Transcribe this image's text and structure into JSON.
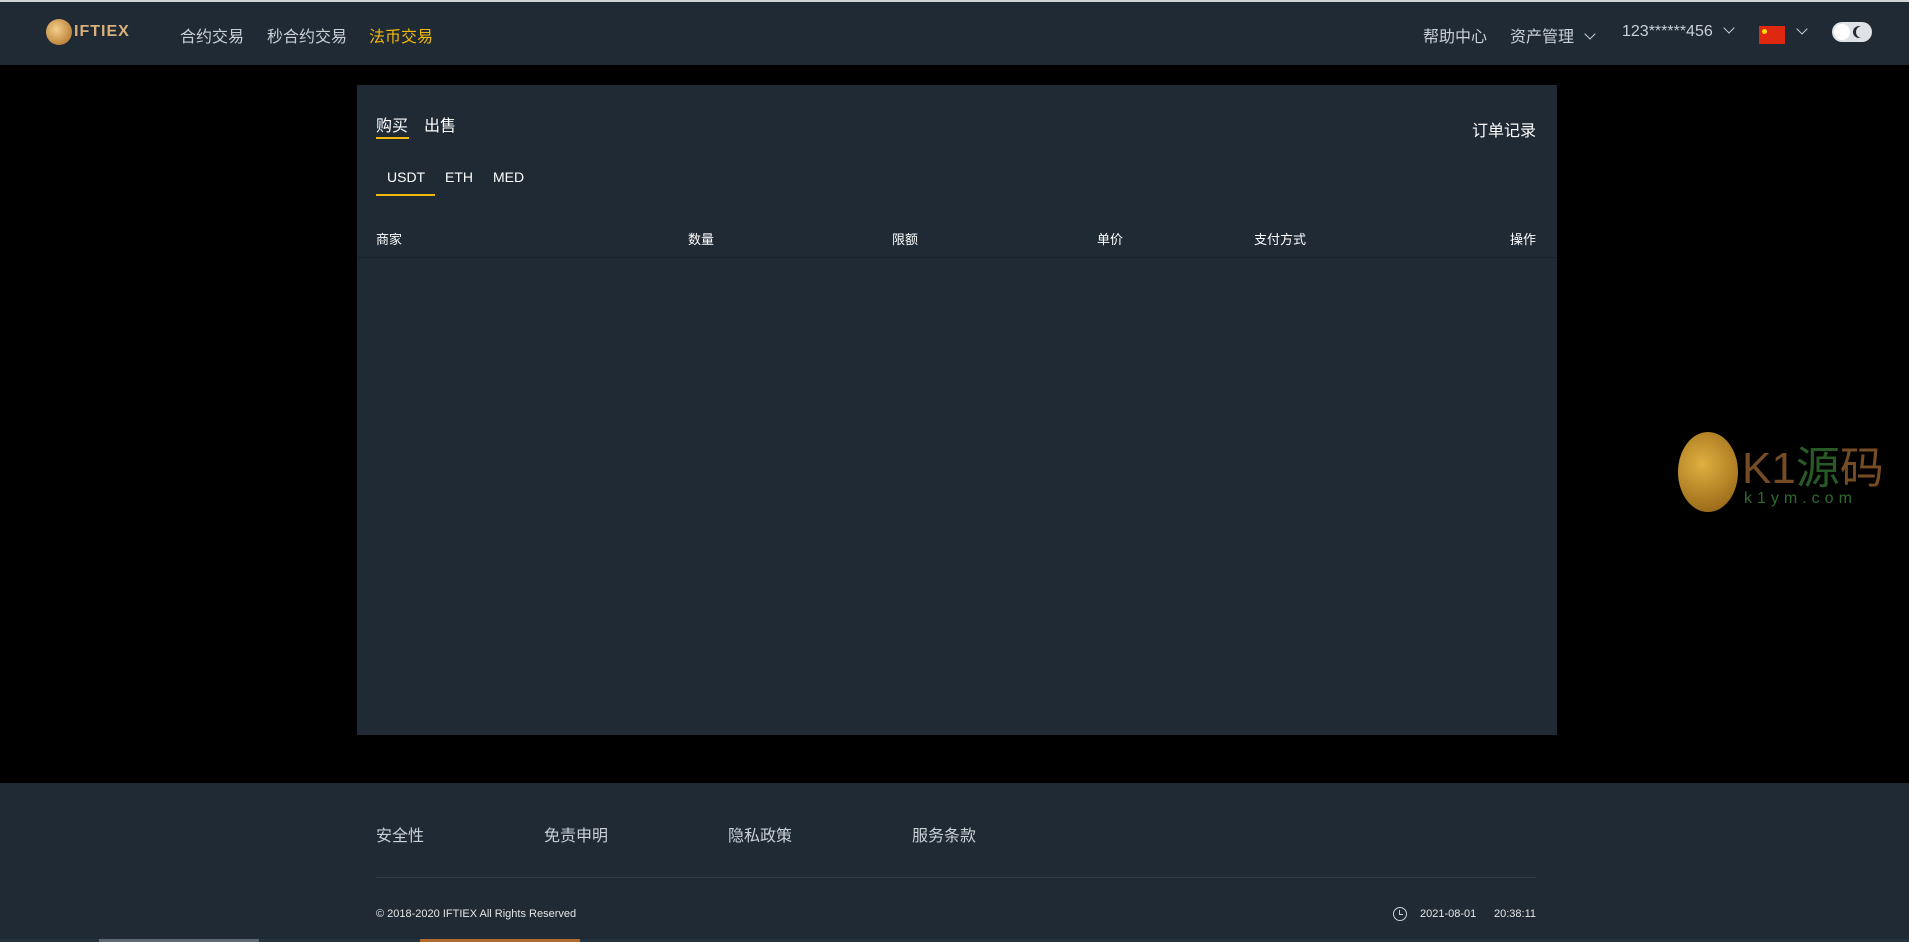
{
  "header": {
    "logo": "IFTIEX",
    "nav": [
      {
        "label": "合约交易"
      },
      {
        "label": "秒合约交易"
      },
      {
        "label": "法币交易",
        "active": true
      }
    ],
    "help": "帮助中心",
    "assets": "资产管理",
    "user": "123******456",
    "language_icon": "china-flag-icon",
    "theme_toggle_icon": "moon-icon"
  },
  "main": {
    "tabs": [
      {
        "label": "购买",
        "active": true
      },
      {
        "label": "出售"
      }
    ],
    "order_records": "订单记录",
    "coins": [
      {
        "label": "USDT",
        "active": true
      },
      {
        "label": "ETH"
      },
      {
        "label": "MED"
      }
    ],
    "columns": [
      "商家",
      "数量",
      "限额",
      "单价",
      "支付方式",
      "操作"
    ],
    "rows": []
  },
  "footer": {
    "links": [
      "安全性",
      "免责申明",
      "隐私政策",
      "服务条款"
    ],
    "copyright": "© 2018-2020 IFTIEX All Rights Reserved",
    "date": "2021-08-01",
    "time": "20:38:11"
  },
  "watermark": {
    "text": "K1源码",
    "url": "k1ym.com"
  },
  "colors": {
    "accent": "#f0b90b",
    "panel": "#1f2a35",
    "background": "#000000"
  }
}
